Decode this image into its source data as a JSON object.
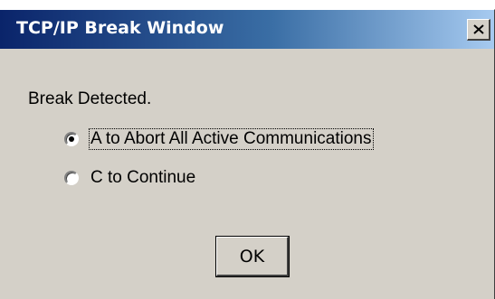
{
  "window": {
    "title": "TCP/IP Break Window",
    "close_glyph": "×"
  },
  "message": "Break Detected.",
  "options": [
    {
      "label": "A to Abort All Active Communications",
      "selected": true,
      "focused": true
    },
    {
      "label": "C to Continue",
      "selected": false,
      "focused": false
    }
  ],
  "ok_button": {
    "label": "OK"
  },
  "colors": {
    "title_start": "#0a246a",
    "title_end": "#a6caf0",
    "face": "#d4d0c8"
  }
}
